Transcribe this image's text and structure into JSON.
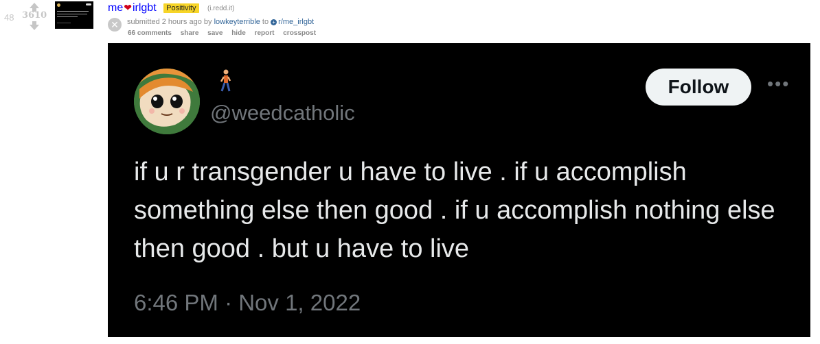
{
  "post": {
    "rank": "48",
    "score": "3610",
    "title_prefix": "me",
    "title_suffix": "irlgbt",
    "flair": "Positivity",
    "domain": "(i.redd.it)",
    "submitted_text": "submitted 2 hours ago by",
    "author": "lowkeyterrible",
    "to_text": "to",
    "subreddit": "r/me_irlgbt",
    "buttons": {
      "comments": "66 comments",
      "share": "share",
      "save": "save",
      "hide": "hide",
      "report": "report",
      "crosspost": "crosspost"
    }
  },
  "tweet": {
    "handle": "@weedcatholic",
    "follow_label": "Follow",
    "more_label": "•••",
    "text": "if u r transgender u have to live . if u accomplish something else then good .  if u accomplish nothing else then good . but u have to live",
    "timestamp": "6:46 PM · Nov 1, 2022"
  },
  "icons": {
    "upvote": "upvote-arrow-icon",
    "downvote": "downvote-arrow-icon",
    "heart": "heart-icon",
    "close": "close-icon",
    "subreddit": "subreddit-icon",
    "walking_person": "person-walking-icon",
    "more": "more-options-icon"
  },
  "colors": {
    "link_blue": "#0000ff",
    "flair_yellow": "#f7d528",
    "media_bg": "#000000",
    "tweet_text": "#e7e9ea",
    "muted": "#71767b",
    "follow_bg": "#eff3f4"
  }
}
